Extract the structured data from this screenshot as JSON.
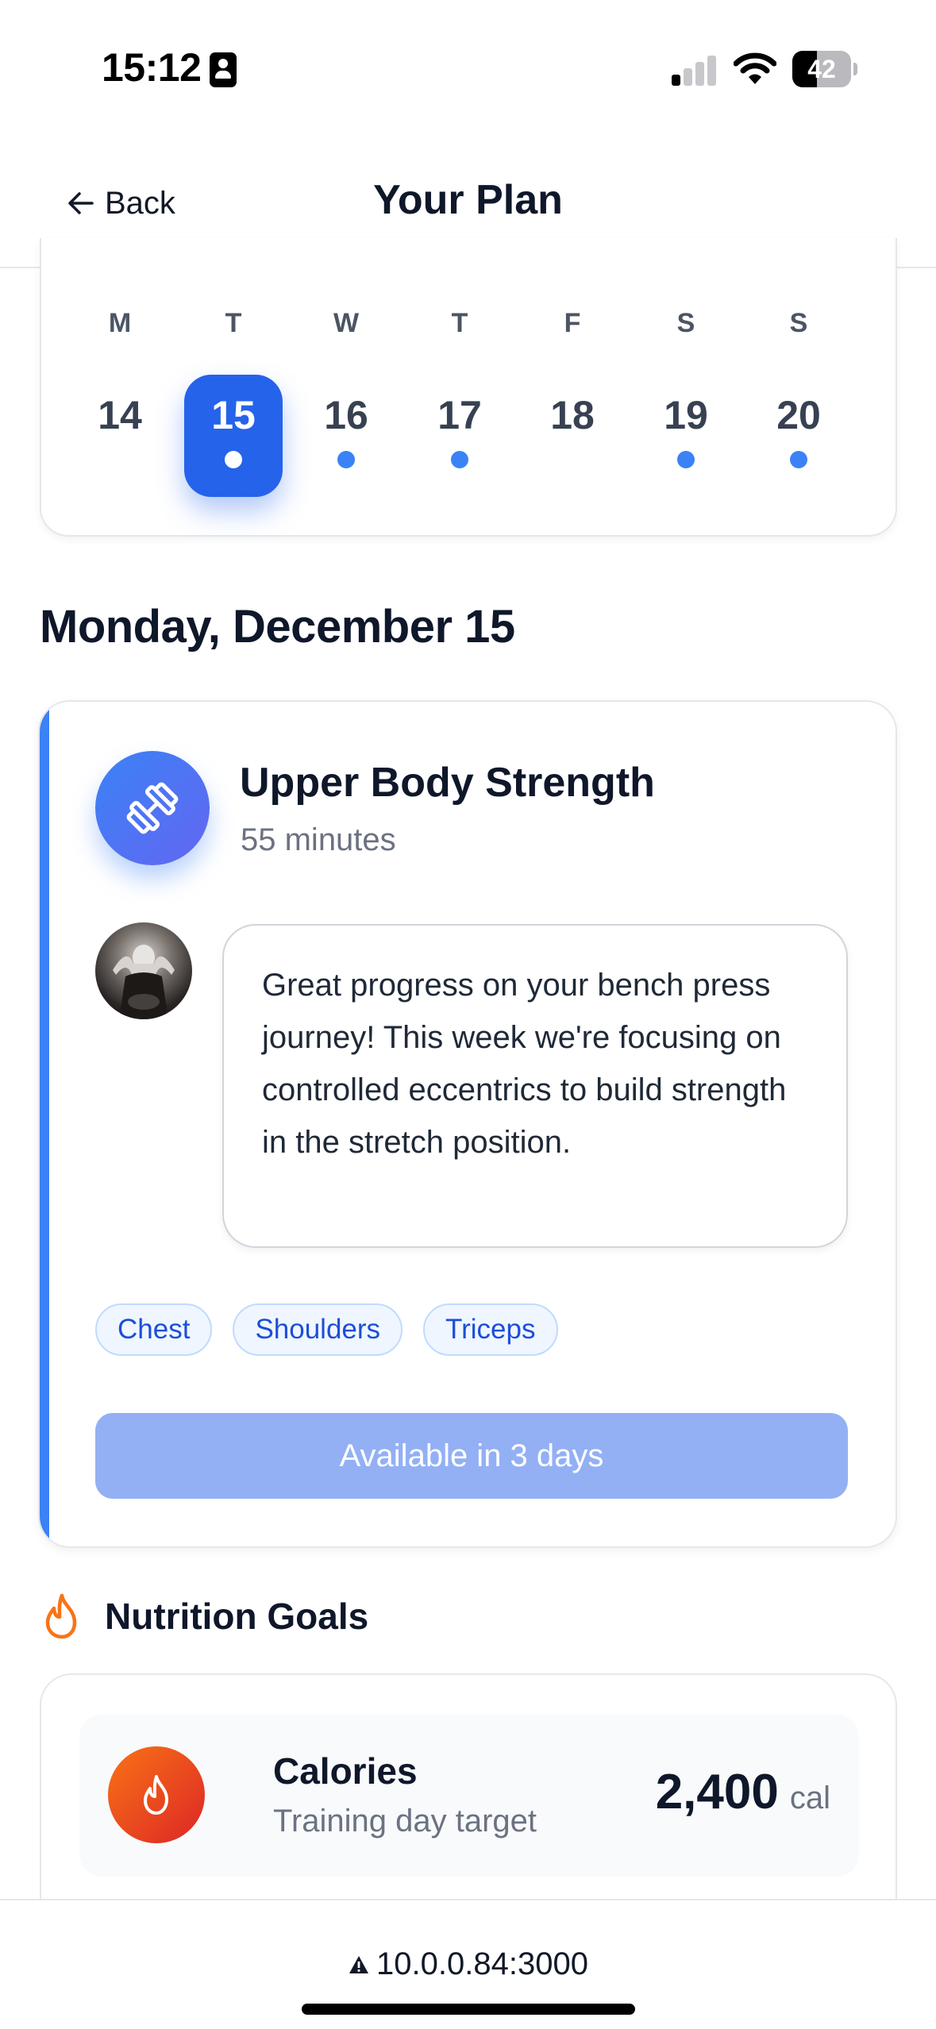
{
  "status_bar": {
    "time": "15:12",
    "battery": "42",
    "battery_level": 0.42
  },
  "header": {
    "back_label": "Back",
    "title": "Your Plan"
  },
  "week": {
    "days": [
      {
        "letter": "M",
        "number": "14",
        "selected": false,
        "has_workout": false
      },
      {
        "letter": "T",
        "number": "15",
        "selected": true,
        "has_workout": true
      },
      {
        "letter": "W",
        "number": "16",
        "selected": false,
        "has_workout": true
      },
      {
        "letter": "T",
        "number": "17",
        "selected": false,
        "has_workout": true
      },
      {
        "letter": "F",
        "number": "18",
        "selected": false,
        "has_workout": false
      },
      {
        "letter": "S",
        "number": "19",
        "selected": false,
        "has_workout": true
      },
      {
        "letter": "S",
        "number": "20",
        "selected": false,
        "has_workout": true
      }
    ]
  },
  "date_heading": "Monday, December 15",
  "workout": {
    "title": "Upper Body Strength",
    "duration": "55 minutes",
    "coach_message": "Great progress on your bench press journey! This week we're focusing on controlled eccentrics to build strength in the stretch position.",
    "tags": [
      "Chest",
      "Shoulders",
      "Triceps"
    ],
    "button_label": "Available in 3 days",
    "icon": "dumbbell-icon",
    "accent_color": "#3b82f6"
  },
  "nutrition": {
    "title": "Nutrition Goals",
    "calories": {
      "label": "Calories",
      "subtitle": "Training day target",
      "value": "2,400",
      "unit": "cal"
    }
  },
  "browser": {
    "url": "10.0.0.84:3000"
  },
  "colors": {
    "primary": "#2563eb",
    "tag_bg": "#eff6ff",
    "tag_text": "#1d4ed8",
    "disabled_button": "#93b0f5",
    "flame": "#f97316"
  }
}
